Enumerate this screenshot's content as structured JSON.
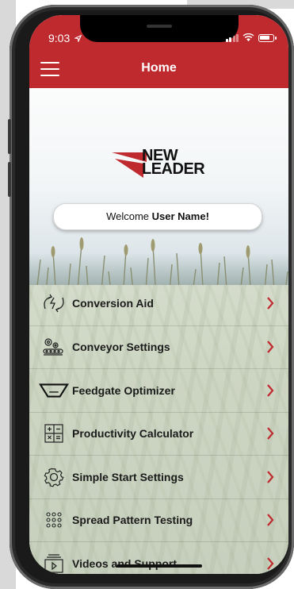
{
  "status_bar": {
    "time": "9:03",
    "location_icon": "location-arrow-icon",
    "icons": [
      "signal-icon",
      "wifi-icon",
      "battery-icon"
    ]
  },
  "header": {
    "title": "Home",
    "menu_icon": "hamburger-menu-icon"
  },
  "logo": {
    "line1": "NEW",
    "line2": "LEADER"
  },
  "welcome": {
    "prefix": "Welcome ",
    "user": "User Name!"
  },
  "menu": {
    "items": [
      {
        "label": "Conversion Aid",
        "icon": "conversion-arrows-icon"
      },
      {
        "label": "Conveyor Settings",
        "icon": "conveyor-gears-icon"
      },
      {
        "label": "Feedgate Optimizer",
        "icon": "feedgate-hopper-icon"
      },
      {
        "label": "Productivity Calculator",
        "icon": "calculator-icon"
      },
      {
        "label": "Simple Start Settings",
        "icon": "gear-icon"
      },
      {
        "label": "Spread Pattern Testing",
        "icon": "dot-grid-icon"
      },
      {
        "label": "Videos and Support",
        "icon": "video-play-icon"
      }
    ]
  },
  "colors": {
    "brand_red": "#bf2a2f",
    "chevron": "#bf2a2f",
    "text": "#1b1b1b"
  }
}
